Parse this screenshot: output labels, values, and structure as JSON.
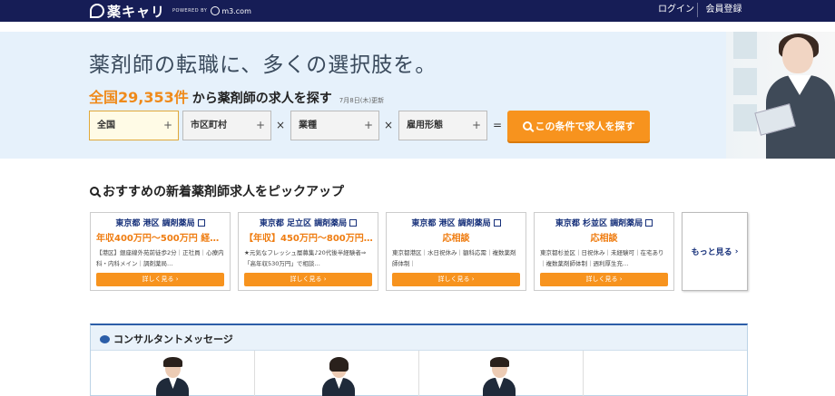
{
  "nav": {
    "brand": "薬キャリ",
    "powered_by": "POWERED BY",
    "partner": "m3.com",
    "login": "ログイン",
    "register": "会員登録"
  },
  "hero": {
    "title": "薬剤師の転職に、多くの選択肢を。",
    "count_prefix": "全国",
    "count_number": "29,353",
    "count_unit": "件",
    "count_rest": "から薬剤師の求人を探す",
    "updated": "7月8日(木)更新",
    "selectors": [
      {
        "label": "全国",
        "plus": "+"
      },
      {
        "label": "市区町村",
        "plus": "+"
      },
      {
        "label": "業種",
        "plus": "+"
      },
      {
        "label": "雇用形態",
        "plus": "+"
      }
    ],
    "op_times": "×",
    "op_equals": "=",
    "search_button": "この条件で求人を探す"
  },
  "pickup": {
    "title": "おすすめの新着薬剤師求人をピックアップ",
    "cards": [
      {
        "location": "東京都 港区 調剤薬局",
        "salary": "年収400万円～500万円 経…",
        "desc": "【港区】銀座線外苑前徒歩2分｜正社員｜心療内科・内科メイン｜調剤薬局…",
        "button": "詳しく見る"
      },
      {
        "location": "東京都 足立区 調剤薬局",
        "salary": "【年収】450万円～800万円…",
        "desc": "★元気なフレッシュ層募集♪20代後半経験者⇒「高年収530万円」で相談…",
        "button": "詳しく見る"
      },
      {
        "location": "東京都 港区 調剤薬局",
        "salary": "応相談",
        "desc": "東京都港区｜水日祝休み｜額科応需｜複数薬剤師体制｜",
        "button": "詳しく見る"
      },
      {
        "location": "東京都 杉並区 調剤薬局",
        "salary": "応相談",
        "desc": "東京都杉並区｜日祝休み｜未経験可｜在宅あり｜複数薬剤師体制｜週利厚生充…",
        "button": "詳しく見る"
      }
    ],
    "more": "もっと見る"
  },
  "consultant": {
    "title": "コンサルタントメッセージ"
  }
}
